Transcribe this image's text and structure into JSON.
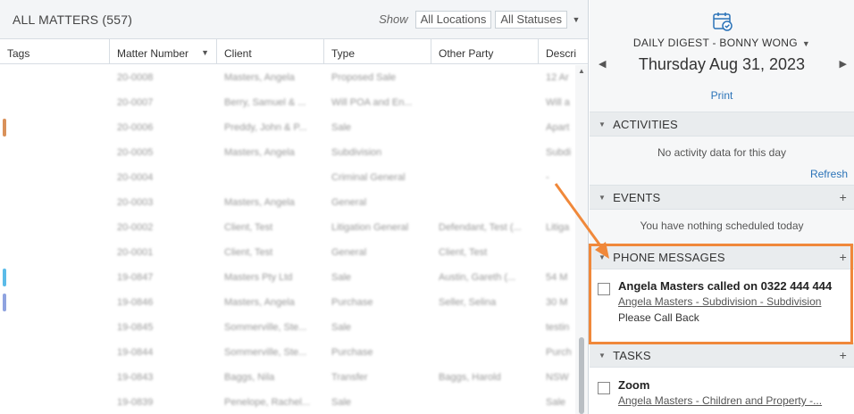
{
  "matters": {
    "title": "ALL MATTERS (557)",
    "show_label": "Show",
    "location_filter": "All Locations",
    "status_filter": "All Statuses",
    "columns": [
      "Tags",
      "Matter Number",
      "Client",
      "Type",
      "Other Party",
      "Descri"
    ],
    "rows": [
      {
        "number": "20-0008",
        "client": "Masters, Angela",
        "type": "Proposed Sale",
        "other": "",
        "desc": "12 Ar",
        "tag": ""
      },
      {
        "number": "20-0007",
        "client": "Berry, Samuel & ...",
        "type": "Will POA and En...",
        "other": "",
        "desc": "Will a",
        "tag": ""
      },
      {
        "number": "20-0006",
        "client": "Preddy, John & P...",
        "type": "Sale",
        "other": "",
        "desc": "Apart",
        "tag": "#d9915a"
      },
      {
        "number": "20-0005",
        "client": "Masters, Angela",
        "type": "Subdivision",
        "other": "",
        "desc": "Subdi",
        "tag": ""
      },
      {
        "number": "20-0004",
        "client": "",
        "type": "Criminal General",
        "other": "",
        "desc": "-",
        "tag": ""
      },
      {
        "number": "20-0003",
        "client": "Masters, Angela",
        "type": "General",
        "other": "",
        "desc": "",
        "tag": ""
      },
      {
        "number": "20-0002",
        "client": "Client, Test",
        "type": "Litigation General",
        "other": "Defendant, Test (...",
        "desc": "Litiga",
        "tag": ""
      },
      {
        "number": "20-0001",
        "client": "Client, Test",
        "type": "General",
        "other": "Client, Test",
        "desc": "",
        "tag": ""
      },
      {
        "number": "19-0847",
        "client": "Masters Pty Ltd",
        "type": "Sale",
        "other": "Austin, Gareth (...",
        "desc": "54 M",
        "tag": "#5bbbe8"
      },
      {
        "number": "19-0846",
        "client": "Masters, Angela",
        "type": "Purchase",
        "other": "Seller, Selina",
        "desc": "30 M",
        "tag": "#8fa3e0"
      },
      {
        "number": "19-0845",
        "client": "Sommerville, Ste...",
        "type": "Sale",
        "other": "",
        "desc": "testin",
        "tag": ""
      },
      {
        "number": "19-0844",
        "client": "Sommerville, Ste...",
        "type": "Purchase",
        "other": "",
        "desc": "Purch",
        "tag": ""
      },
      {
        "number": "19-0843",
        "client": "Baggs, Nila",
        "type": "Transfer",
        "other": "Baggs, Harold",
        "desc": "NSW",
        "tag": ""
      },
      {
        "number": "19-0839",
        "client": "Penelope, Rachel...",
        "type": "Sale",
        "other": "",
        "desc": "Sale",
        "tag": ""
      }
    ]
  },
  "digest": {
    "title": "DAILY DIGEST - BONNY WONG",
    "date": "Thursday Aug 31, 2023",
    "print": "Print",
    "sections": {
      "activities": {
        "label": "ACTIVITIES",
        "empty": "No activity data for this day",
        "refresh": "Refresh"
      },
      "events": {
        "label": "EVENTS",
        "empty": "You have nothing scheduled today"
      },
      "phone": {
        "label": "PHONE MESSAGES",
        "item_head": "Angela Masters called on 0322 444 444",
        "item_link": "Angela Masters - Subdivision - Subdivision",
        "item_note": "Please Call Back"
      },
      "tasks": {
        "label": "TASKS",
        "item_head": "Zoom",
        "item_link": "Angela Masters - Children and Property -..."
      }
    }
  },
  "accent": {
    "link": "#2b73b8",
    "highlight": "#f0883a"
  }
}
